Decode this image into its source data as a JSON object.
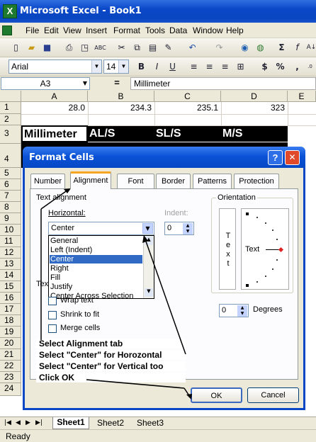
{
  "window": {
    "title": "Microsoft Excel - Book1"
  },
  "menu": [
    "File",
    "Edit",
    "View",
    "Insert",
    "Format",
    "Tools",
    "Data",
    "Window",
    "Help"
  ],
  "format_toolbar": {
    "font": "Arial",
    "size": "14"
  },
  "formula_bar": {
    "name_box": "A3",
    "fx": "=",
    "content": "Millimeter"
  },
  "sheet": {
    "columns": [
      "A",
      "B",
      "C",
      "D",
      "E"
    ],
    "rows": [
      "1",
      "2",
      "3",
      "4",
      "5",
      "6",
      "7",
      "8",
      "9",
      "10",
      "11",
      "12",
      "13",
      "14",
      "15",
      "16",
      "17",
      "18",
      "19",
      "20",
      "21",
      "22",
      "23",
      "24"
    ],
    "row1": [
      "28.0",
      "234.3",
      "235.1",
      "323"
    ],
    "row3": [
      "Millimeter",
      "AL/S",
      "SL/S",
      "M/S"
    ]
  },
  "dialog": {
    "title": "Format Cells",
    "help": "?",
    "close": "✕",
    "tabs": [
      "Number",
      "Alignment",
      "Font",
      "Border",
      "Patterns",
      "Protection"
    ],
    "text_alignment_label": "Text alignment",
    "horizontal_label": "Horizontal:",
    "horizontal_value": "Center",
    "horizontal_options": [
      "General",
      "Left (Indent)",
      "Center",
      "Right",
      "Fill",
      "Justify",
      "Center Across Selection"
    ],
    "indent_label": "Indent:",
    "indent_value": "0",
    "text_control_label": "Tex",
    "wrap_text": "Wrap text",
    "shrink_to_fit": "Shrink to fit",
    "merge_cells": "Merge cells",
    "orientation_label": "Orientation",
    "orientation_vertical_text": "T e x t",
    "orientation_dial_text": "Text",
    "degrees_value": "0",
    "degrees_label": "Degrees",
    "ok": "OK",
    "cancel": "Cancel"
  },
  "annotations": [
    "Select Alignment tab",
    "Select \"Center\" for Horozontal",
    "Select \"Center\" for Vertical too",
    "Click OK"
  ],
  "sheet_tabs": [
    "Sheet1",
    "Sheet2",
    "Sheet3"
  ],
  "status": "Ready"
}
